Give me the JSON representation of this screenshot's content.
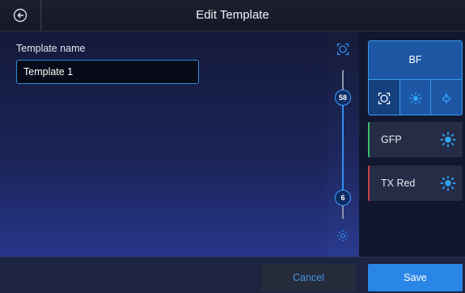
{
  "header": {
    "title": "Edit Template",
    "back_icon": "back-arrow-icon"
  },
  "form": {
    "name_label": "Template name",
    "name_value": "Template 1"
  },
  "focus": {
    "coarse_value": "58",
    "fine_value": "6",
    "top_icon": "autofocus-icon",
    "bottom_icon": "focus-dim-icon"
  },
  "channels": {
    "bf": {
      "label": "BF",
      "tools": [
        "autofocus-icon",
        "brightness-icon",
        "light-adjust-icon"
      ],
      "selected_tool": 0
    },
    "gfp": {
      "label": "GFP",
      "icon": "brightness-icon",
      "accent": "#3dbd6a"
    },
    "txred": {
      "label": "TX Red",
      "icon": "brightness-icon",
      "accent": "#c9434e"
    }
  },
  "footer": {
    "cancel_label": "Cancel",
    "save_label": "Save"
  },
  "colors": {
    "accent": "#2a86e6",
    "selected_channel": "#1d56a3"
  }
}
